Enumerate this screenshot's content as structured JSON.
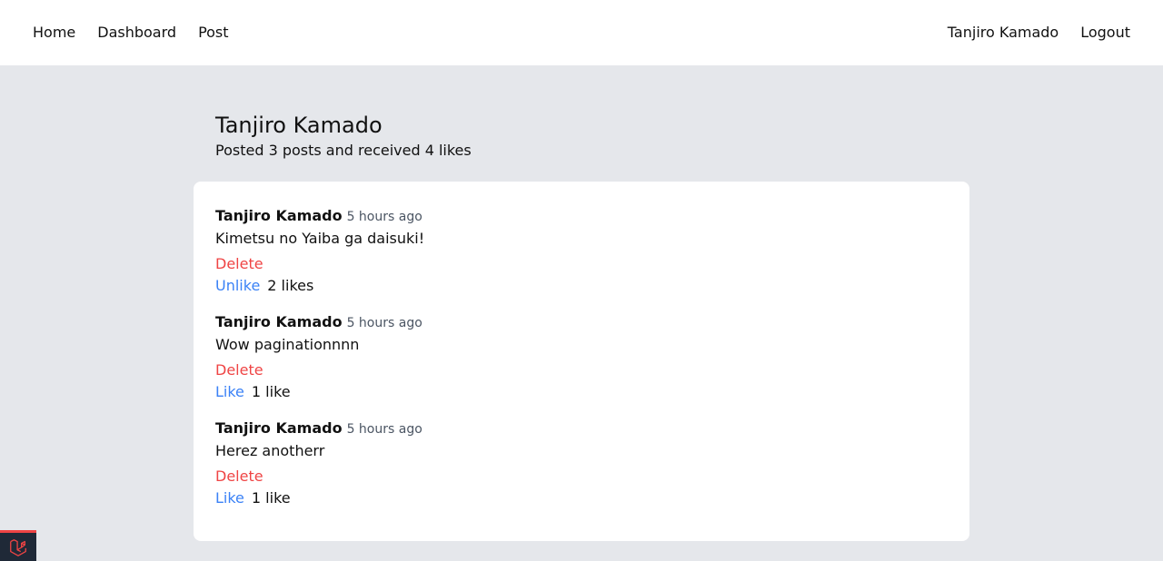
{
  "nav": {
    "home": "Home",
    "dashboard": "Dashboard",
    "post": "Post",
    "user": "Tanjiro Kamado",
    "logout": "Logout"
  },
  "profile": {
    "name": "Tanjiro Kamado",
    "stats": "Posted 3 posts and received 4 likes"
  },
  "posts": [
    {
      "author": "Tanjiro Kamado",
      "time": "5 hours ago",
      "body": "Kimetsu no Yaiba ga daisuki!",
      "delete_label": "Delete",
      "like_label": "Unlike",
      "likes": "2 likes"
    },
    {
      "author": "Tanjiro Kamado",
      "time": "5 hours ago",
      "body": "Wow paginationnnn",
      "delete_label": "Delete",
      "like_label": "Like",
      "likes": "1 like"
    },
    {
      "author": "Tanjiro Kamado",
      "time": "5 hours ago",
      "body": "Herez anotherr",
      "delete_label": "Delete",
      "like_label": "Like",
      "likes": "1 like"
    }
  ],
  "colors": {
    "background": "#e5e7eb",
    "delete": "#ef4444",
    "like": "#3b82f6"
  },
  "icons": {
    "badge": "laravel-logo-icon"
  }
}
